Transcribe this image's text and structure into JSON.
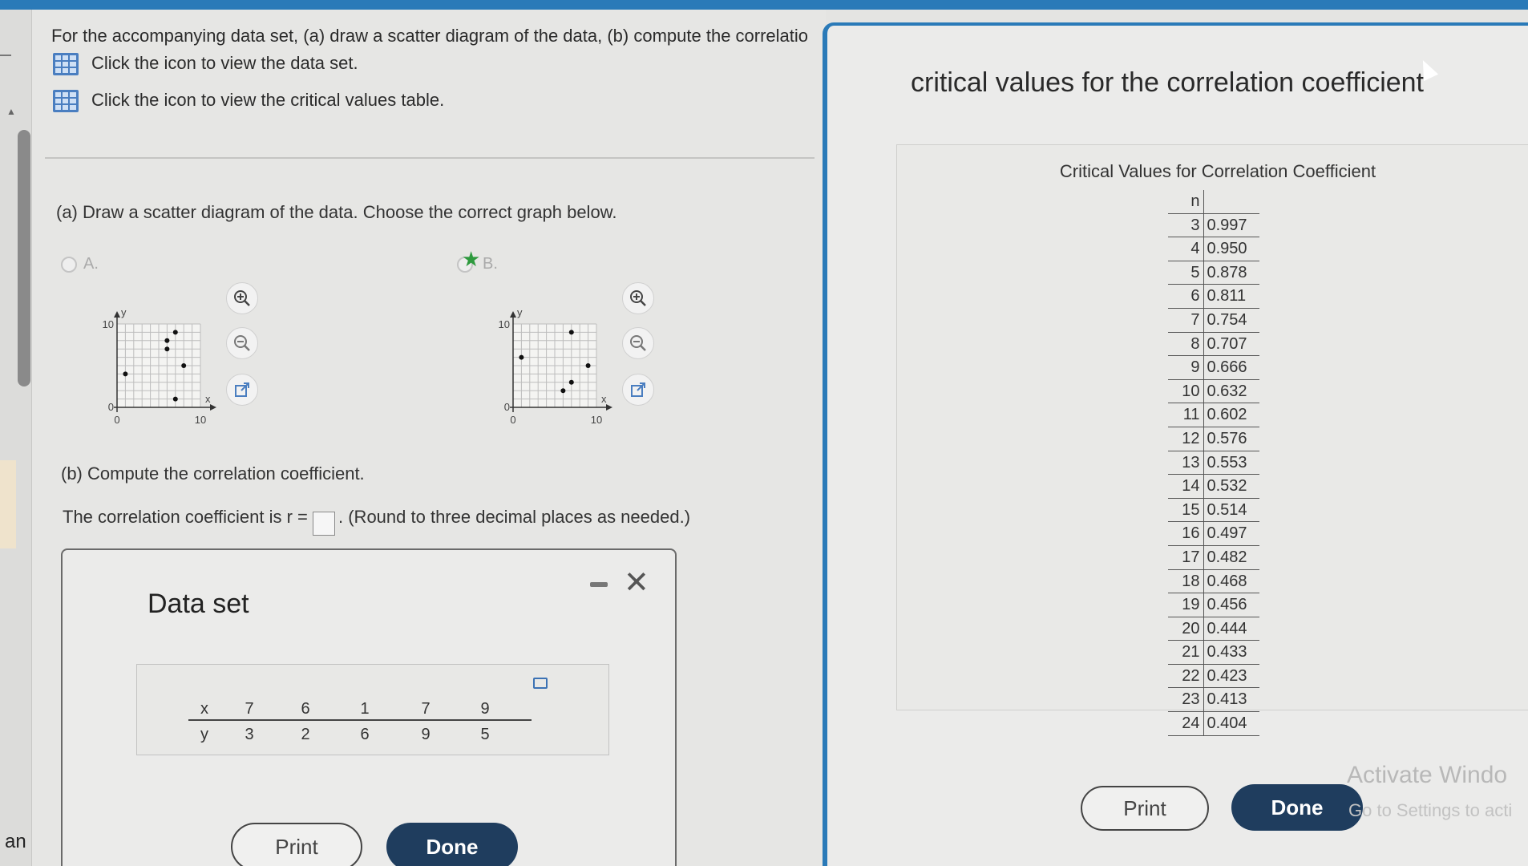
{
  "instructions": {
    "line1": "For the accompanying data set, (a) draw a scatter diagram of the data, (b) compute the correlatio",
    "line2": "Click the icon to view the data set.",
    "line3": "Click the icon to view the critical values table."
  },
  "part_a": {
    "prompt": "(a) Draw a scatter diagram of the data. Choose the correct graph below.",
    "option_a_label": "A.",
    "option_b_label": "B.",
    "selected": "B",
    "axis": {
      "y_label": "y",
      "x_label": "x",
      "y_max_label": "10",
      "origin_y_label": "0",
      "origin_x_label": "0",
      "x_max_label": "10",
      "xlim": [
        0,
        10
      ],
      "ylim": [
        0,
        10
      ]
    },
    "graph_a_points": [
      [
        7,
        9
      ],
      [
        6,
        7
      ],
      [
        1,
        4
      ],
      [
        8,
        5
      ],
      [
        7,
        1
      ],
      [
        6,
        8
      ]
    ],
    "graph_b_points": [
      [
        7,
        9
      ],
      [
        1,
        6
      ],
      [
        7,
        3
      ],
      [
        9,
        5
      ],
      [
        6,
        2
      ]
    ]
  },
  "part_b": {
    "prompt": "(b) Compute the correlation coefficient.",
    "answer_prefix": "The correlation coefficient is r =",
    "answer_suffix": ". (Round to three decimal places as needed.)"
  },
  "data_modal": {
    "title": "Data set",
    "x_label": "x",
    "y_label": "y",
    "x_values": [
      "7",
      "6",
      "1",
      "7",
      "9"
    ],
    "y_values": [
      "3",
      "2",
      "6",
      "9",
      "5"
    ],
    "print_label": "Print",
    "done_label": "Done"
  },
  "critical_panel": {
    "title": "critical values for the correlation coefficient",
    "caption": "Critical Values for Correlation Coefficient",
    "n_header": "n",
    "rows": [
      [
        "3",
        "0.997"
      ],
      [
        "4",
        "0.950"
      ],
      [
        "5",
        "0.878"
      ],
      [
        "6",
        "0.811"
      ],
      [
        "7",
        "0.754"
      ],
      [
        "8",
        "0.707"
      ],
      [
        "9",
        "0.666"
      ],
      [
        "10",
        "0.632"
      ],
      [
        "11",
        "0.602"
      ],
      [
        "12",
        "0.576"
      ],
      [
        "13",
        "0.553"
      ],
      [
        "14",
        "0.532"
      ],
      [
        "15",
        "0.514"
      ],
      [
        "16",
        "0.497"
      ],
      [
        "17",
        "0.482"
      ],
      [
        "18",
        "0.468"
      ],
      [
        "19",
        "0.456"
      ],
      [
        "20",
        "0.444"
      ],
      [
        "21",
        "0.433"
      ],
      [
        "22",
        "0.423"
      ],
      [
        "23",
        "0.413"
      ],
      [
        "24",
        "0.404"
      ]
    ],
    "print_label": "Print",
    "done_label": "Done"
  },
  "watermark": {
    "line1": "Activate Windo",
    "line2": "Go to Settings to acti"
  },
  "side_label": "an",
  "icons": {
    "grid": "table-grid-icon",
    "zoom_in": "zoom-in-icon",
    "zoom_out": "zoom-out-icon",
    "external": "open-external-icon",
    "close": "close-icon",
    "minimize": "minimize-icon"
  },
  "colors": {
    "accent": "#2a7ab8",
    "done_button": "#1f3d5e",
    "selected_star": "#2e9a3e",
    "icon_blue": "#4a7ec0"
  }
}
